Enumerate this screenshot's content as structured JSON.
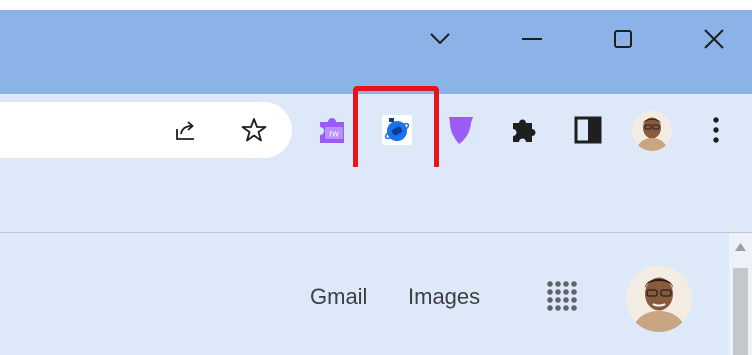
{
  "window_controls": {
    "tab_search_icon": "chevron-down",
    "minimize_icon": "minimize",
    "maximize_icon": "maximize",
    "close_icon": "close"
  },
  "omnibox": {
    "icons": [
      "share-icon",
      "bookmark-star-icon"
    ]
  },
  "toolbar": {
    "extensions": [
      {
        "name": "rw-extension",
        "label": "rw",
        "color": "#9b5cf6"
      },
      {
        "name": "highlighted-extension",
        "color": "#1a73e8"
      },
      {
        "name": "purple-shield-extension",
        "color": "#9b5cf6"
      }
    ],
    "extensions_menu_icon": "puzzle-piece",
    "side_panel_icon": "side-panel",
    "more_menu_icon": "three-dots-vertical"
  },
  "highlight_color": "#e8141b",
  "page": {
    "gmail_link": "Gmail",
    "images_link": "Images",
    "apps_icon": "apps-grid"
  },
  "colors": {
    "tabstrip": "#8bb3e8",
    "toolbar": "#dde8f8",
    "icon": "#1f1f1f"
  }
}
